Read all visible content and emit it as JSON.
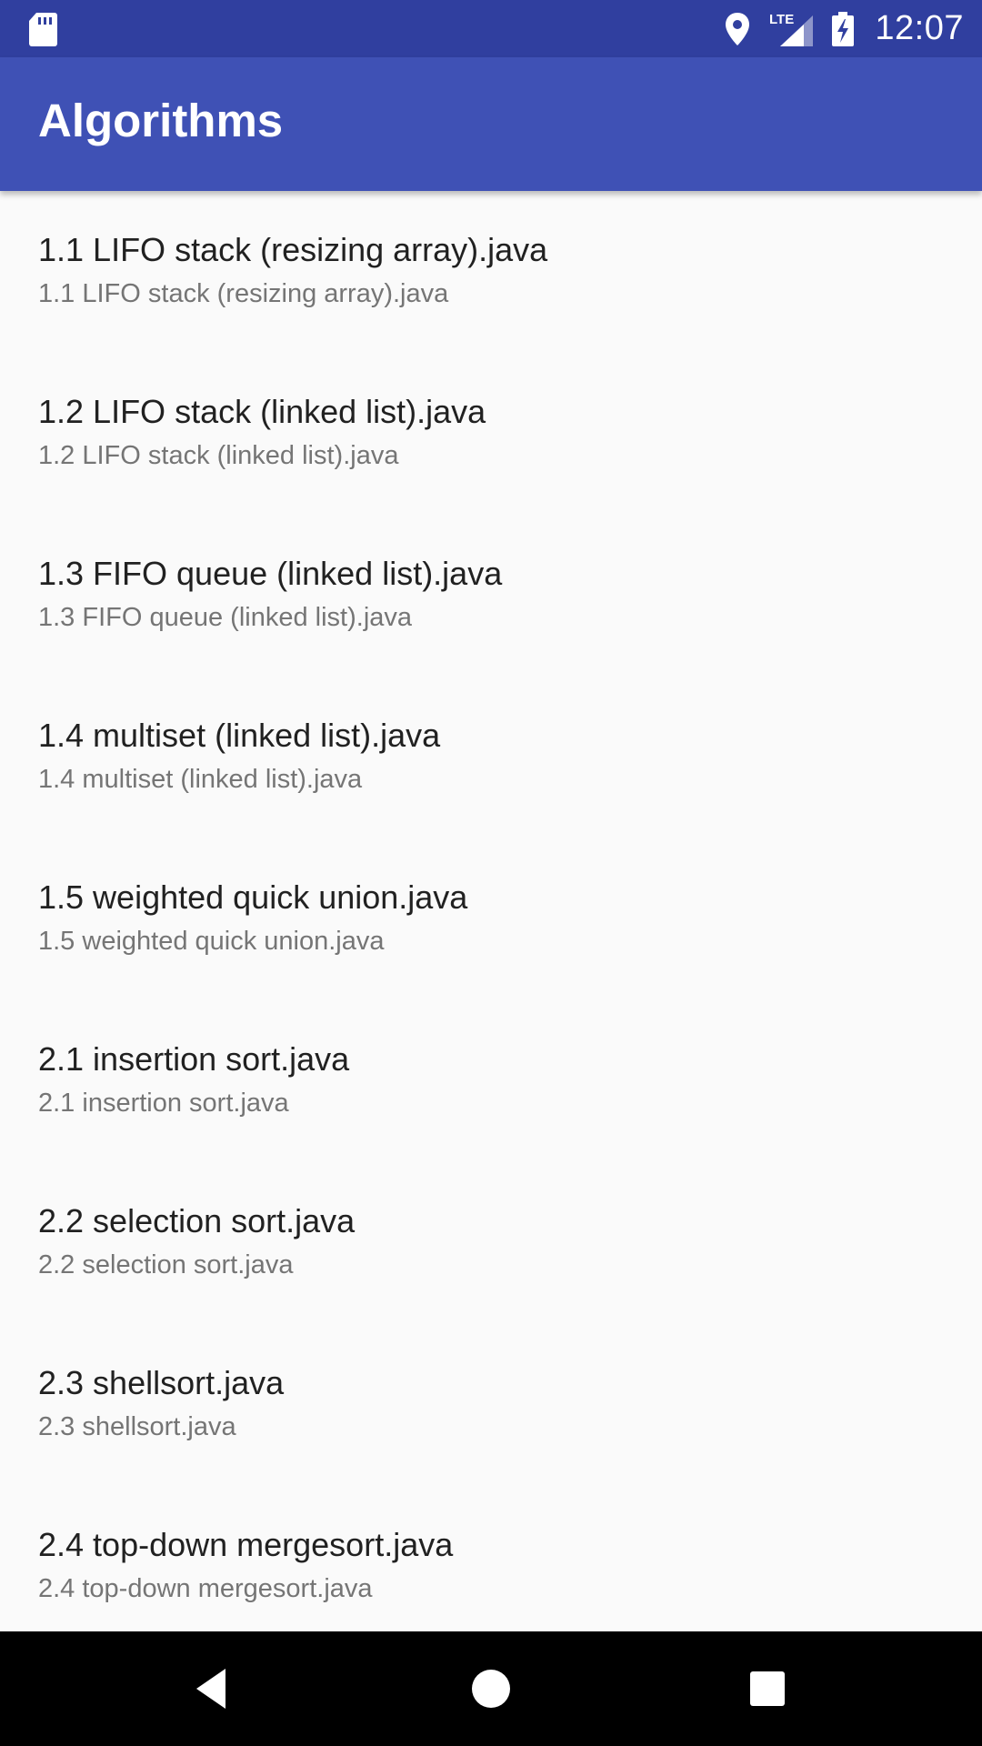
{
  "status_bar": {
    "time": "12:07",
    "network_label": "LTE",
    "icons": [
      "sd-card-icon",
      "location-icon",
      "signal-icon",
      "battery-charging-icon"
    ]
  },
  "app_bar": {
    "title": "Algorithms"
  },
  "colors": {
    "status_bar": "#303f9f",
    "app_bar": "#3f51b5",
    "background": "#fafafa",
    "primary_text": "#212121",
    "secondary_text": "#757575",
    "nav_bar": "#000000"
  },
  "list": {
    "items": [
      {
        "primary": "1.1 LIFO stack (resizing array).java",
        "secondary": "1.1 LIFO stack (resizing array).java"
      },
      {
        "primary": "1.2 LIFO stack (linked list).java",
        "secondary": "1.2 LIFO stack (linked list).java"
      },
      {
        "primary": "1.3 FIFO queue (linked list).java",
        "secondary": "1.3 FIFO queue (linked list).java"
      },
      {
        "primary": "1.4 multiset (linked list).java",
        "secondary": "1.4 multiset (linked list).java"
      },
      {
        "primary": "1.5 weighted quick union.java",
        "secondary": "1.5 weighted quick union.java"
      },
      {
        "primary": "2.1 insertion sort.java",
        "secondary": "2.1 insertion sort.java"
      },
      {
        "primary": "2.2 selection sort.java",
        "secondary": "2.2 selection sort.java"
      },
      {
        "primary": "2.3 shellsort.java",
        "secondary": "2.3 shellsort.java"
      },
      {
        "primary": "2.4 top-down mergesort.java",
        "secondary": "2.4 top-down mergesort.java"
      }
    ]
  },
  "nav_bar": {
    "buttons": [
      "back-icon",
      "home-icon",
      "recents-icon"
    ]
  }
}
